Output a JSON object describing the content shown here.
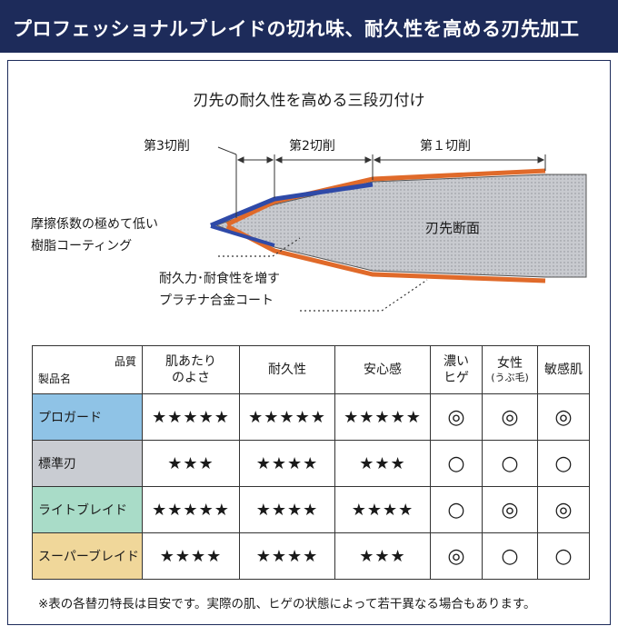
{
  "header": {
    "title": "プロフェッショナルブレイドの切れ味、耐久性を高める刃先加工"
  },
  "diagram": {
    "subtitle": "刃先の耐久性を高める三段刃付け",
    "cut3_label": "第3切削",
    "cut2_label": "第2切削",
    "cut1_label": "第１切削",
    "cross_section_label": "刃先断面",
    "coating_label_line1": "摩擦係数の極めて低い",
    "coating_label_line2": "樹脂コーティング",
    "plating_label_line1": "耐久力･耐食性を増す",
    "plating_label_line2": "プラチナ合金コート",
    "colors": {
      "resin_coat": "#2f4aa8",
      "platinum_coat": "#e06a2a",
      "section_fill": "#d6d8dc",
      "header_bg": "#1d2b5a"
    }
  },
  "table": {
    "corner_quality": "品質",
    "corner_product": "製品名",
    "columns": [
      {
        "label": "肌あたり\nのよさ"
      },
      {
        "label": "耐久性"
      },
      {
        "label": "安心感"
      },
      {
        "label": "濃い\nヒゲ"
      },
      {
        "label": "女性",
        "sub": "(うぶ毛)"
      },
      {
        "label": "敏感肌"
      }
    ],
    "rows": [
      {
        "name": "プロガード",
        "color": "#8fc3e6",
        "values": [
          "★★★★★",
          "★★★★★",
          "★★★★★",
          "◎",
          "◎",
          "◎"
        ]
      },
      {
        "name": "標準刃",
        "color": "#c9ccd2",
        "values": [
          "★★★",
          "★★★★",
          "★★★",
          "○",
          "○",
          "○"
        ]
      },
      {
        "name": "ライトブレイド",
        "color": "#a9dcc8",
        "values": [
          "★★★★★",
          "★★★★",
          "★★★★",
          "○",
          "◎",
          "◎"
        ]
      },
      {
        "name": "スーパーブレイド",
        "color": "#f0d79a",
        "values": [
          "★★★★",
          "★★★★",
          "★★★",
          "◎",
          "○",
          "○"
        ]
      }
    ]
  },
  "footnote": "※表の各替刃特長は目安です。実際の肌、ヒゲの状態によって若干異なる場合もあります。"
}
